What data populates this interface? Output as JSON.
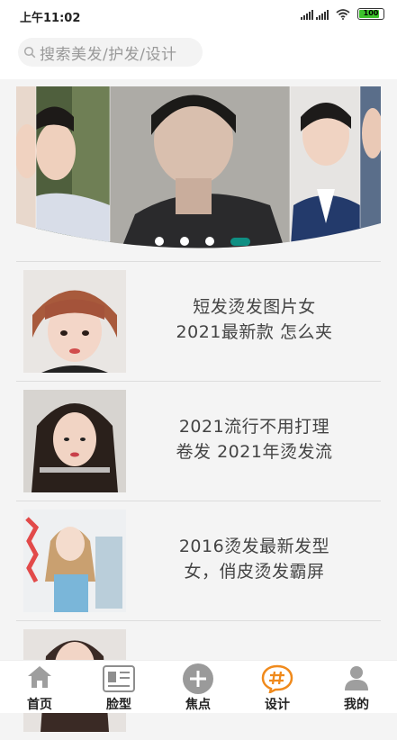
{
  "status_bar": {
    "time": "上午11:02",
    "battery": "100"
  },
  "search": {
    "placeholder": "搜索美发/护发/设计"
  },
  "banner": {
    "active_index": 3,
    "dot_count": 4
  },
  "list": [
    {
      "title_line1": "短发烫发图片女",
      "title_line2": "2021最新款 怎么夹"
    },
    {
      "title_line1": "2021流行不用打理",
      "title_line2": "卷发 2021年烫发流"
    },
    {
      "title_line1": "2016烫发最新发型",
      "title_line2": "女，俏皮烫发霸屏"
    },
    {
      "title_line1": "",
      "title_line2": ""
    }
  ],
  "tabs": [
    {
      "label": "首页",
      "icon": "home-icon"
    },
    {
      "label": "脸型",
      "icon": "face-shape-icon"
    },
    {
      "label": "焦点",
      "icon": "plus-icon"
    },
    {
      "label": "设计",
      "icon": "hashtag-icon"
    },
    {
      "label": "我的",
      "icon": "user-icon"
    }
  ],
  "colors": {
    "accent": "#0f8f83",
    "design_tab": "#f08a1c"
  }
}
